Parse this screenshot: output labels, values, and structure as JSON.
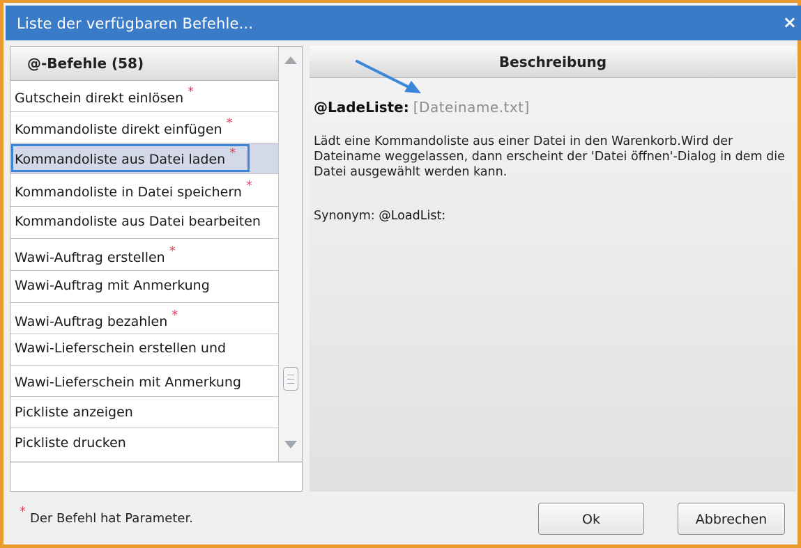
{
  "window": {
    "title": "Liste der verfügbaren  Befehle...",
    "close_glyph": "×"
  },
  "list": {
    "header": "@-Befehle (58)",
    "items": [
      {
        "label": "Gutschein direkt einlösen",
        "star": "*"
      },
      {
        "label": "Kommandoliste direkt einfügen",
        "star": "*"
      },
      {
        "label": "Kommandoliste aus Datei laden",
        "star": "*",
        "selected": true
      },
      {
        "label": "Kommandoliste in Datei speichern",
        "star": "*"
      },
      {
        "label": "Kommandoliste aus Datei bearbeiten",
        "star": ""
      },
      {
        "label": "Wawi-Auftrag erstellen",
        "star": "*"
      },
      {
        "label": "Wawi-Auftrag mit Anmerkung",
        "star": ""
      },
      {
        "label": "Wawi-Auftrag bezahlen",
        "star": "*"
      },
      {
        "label": "Wawi-Lieferschein erstellen und",
        "star": ""
      },
      {
        "label": "Wawi-Lieferschein mit Anmerkung",
        "star": ""
      },
      {
        "label": "Pickliste anzeigen",
        "star": ""
      },
      {
        "label": "Pickliste drucken",
        "star": ""
      }
    ]
  },
  "description": {
    "header": "Beschreibung",
    "command": "@LadeListe:",
    "parameter": "[Dateiname.txt]",
    "text": "Lädt eine Kommandoliste aus einer Datei in den Warenkorb.Wird der Dateiname weggelassen, dann erscheint der 'Datei öffnen'-Dialog in dem die Datei ausgewählt werden kann.",
    "synonym_label": "Synonym:",
    "synonym_value": "@LoadList:"
  },
  "footer": {
    "note_star": "*",
    "note": "Der Befehl hat Parameter.",
    "ok_label": "Ok",
    "cancel_label": "Abbrechen"
  },
  "colors": {
    "title_bar": "#3a7bc8",
    "frame": "#e89a2c",
    "star": "#e0455f",
    "selection_border": "#3a86d8",
    "annotation_arrow": "#3a86d8"
  }
}
